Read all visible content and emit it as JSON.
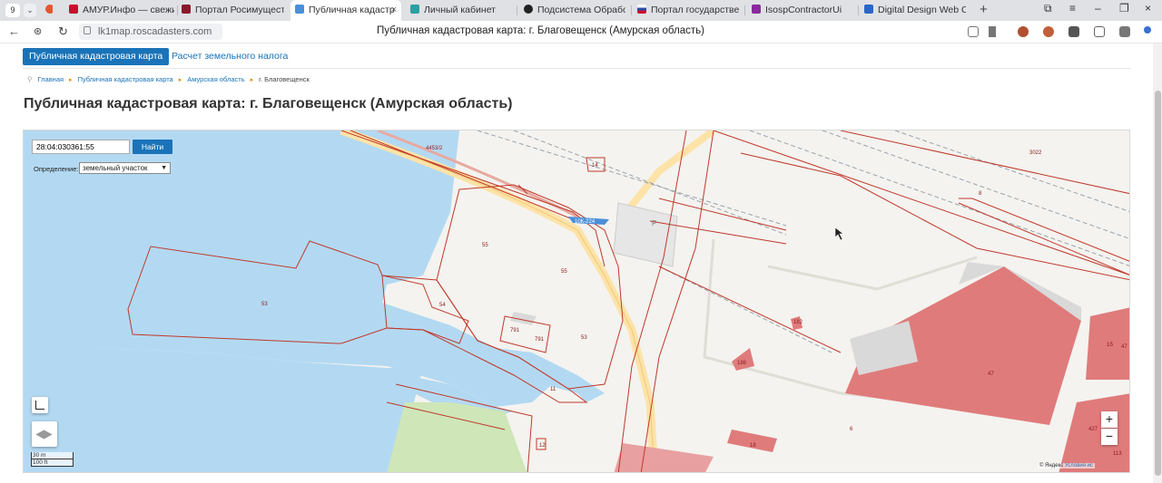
{
  "browser": {
    "tab_count": "9",
    "tabs": [
      {
        "label": "АМУР.Инфо — свежие",
        "color": "#c8102e"
      },
      {
        "label": "Портал Росимущества",
        "color": "#8a1a2b"
      },
      {
        "label": "Публичная кадастр",
        "color": "#4a8fd8"
      },
      {
        "label": "Личный кабинет",
        "color": "#2aa0a0"
      },
      {
        "label": "Подсистема Обработк",
        "color": "#222222"
      },
      {
        "label": "Портал государствен",
        "color": "#2b4fa8"
      },
      {
        "label": "IsospContractorUi",
        "color": "#8a2a9e"
      },
      {
        "label": "Digital Design Web Clie",
        "color": "#2a66c8"
      }
    ],
    "url": "lk1map.roscadasters.com",
    "page_title": "Публичная кадастровая карта: г. Благовещенск (Амурская область)"
  },
  "nav": {
    "primary_button": "Публичная кадастровая карта",
    "tax_link": "Расчет земельного налога"
  },
  "breadcrumbs": [
    "Главная",
    "Публичная кадастровая карта",
    "Амурская область",
    "г. Благовещенск"
  ],
  "heading": "Публичная кадастровая карта: г. Благовещенск (Амурская область)",
  "map": {
    "search_value": "28:04:030361:55",
    "search_button": "Найти",
    "definition_label": "Определение:",
    "definition_value": "земельный участок",
    "zoom_in": "+",
    "zoom_out": "−",
    "scale_m": "30 m",
    "scale_ft": "100 ft",
    "copyright": "© Яндекс",
    "terms": "Условия ис",
    "road_label": "10К-224",
    "parking_label": "P",
    "parcel_labels": [
      "4453/2",
      "55",
      "55",
      "53",
      "54",
      "791",
      "791",
      "53",
      "11",
      "12",
      "14",
      "3022",
      "8",
      "182",
      "186",
      "47",
      "6",
      "18",
      "1б",
      "47",
      "427",
      "113"
    ]
  }
}
